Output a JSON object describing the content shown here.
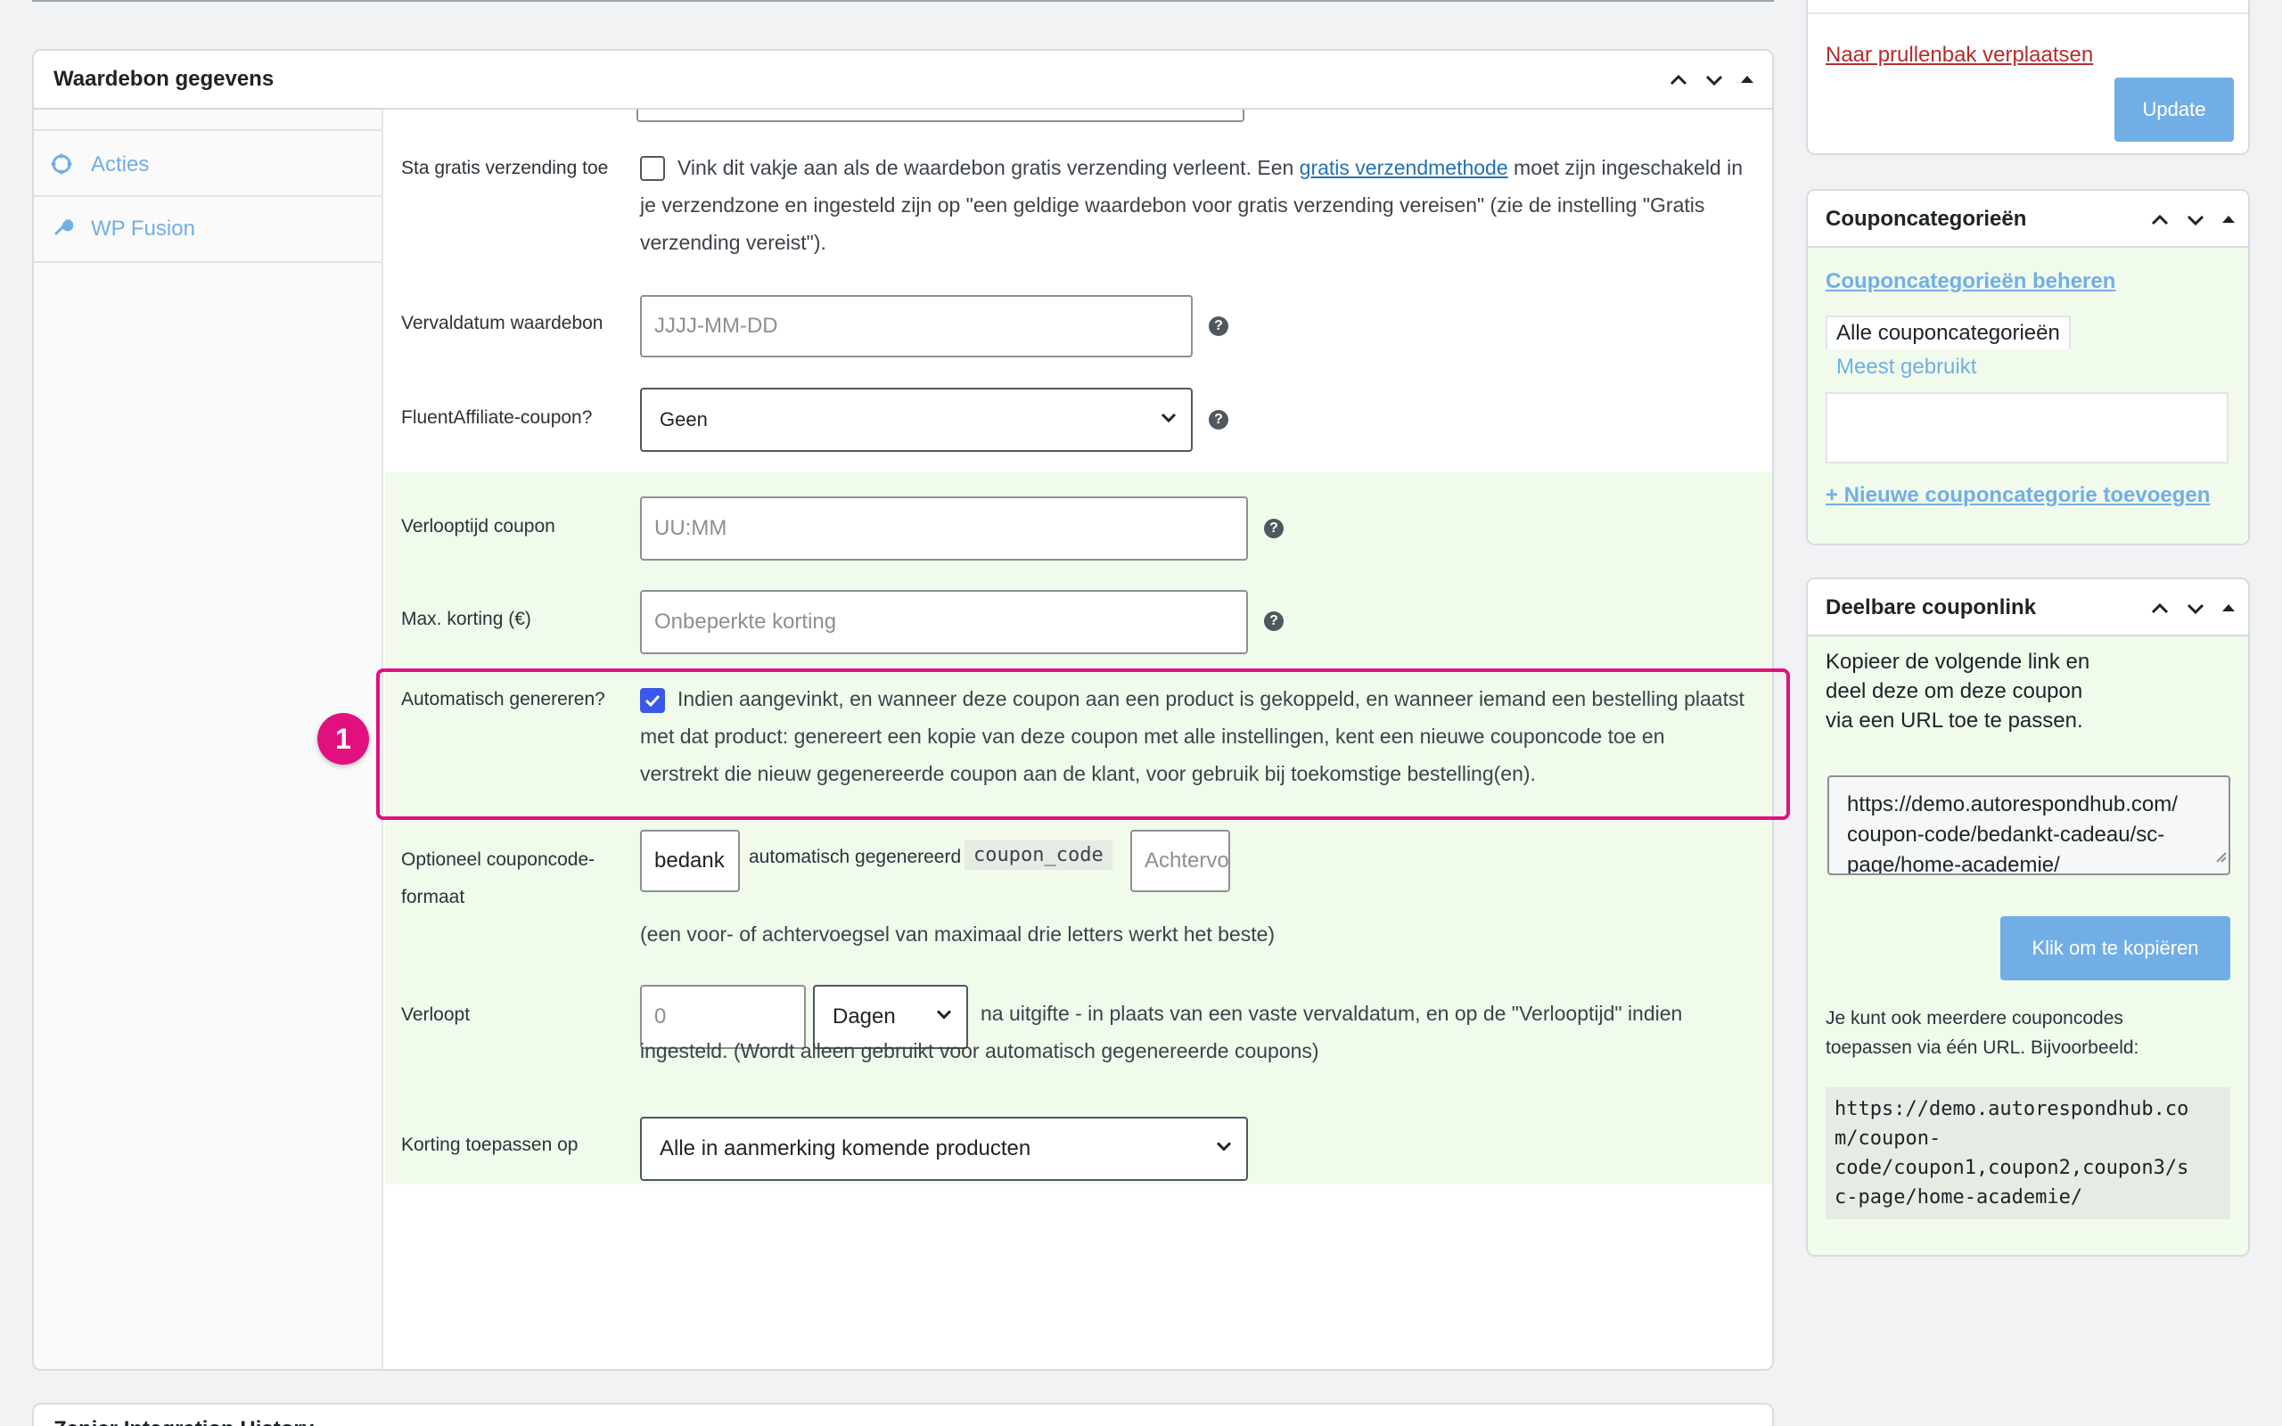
{
  "main_panel": {
    "title": "Waardebon gegevens",
    "sidebar": [
      {
        "label": "Acties",
        "icon": "gear-icon"
      },
      {
        "label": "WP Fusion",
        "icon": "wrench-icon"
      }
    ],
    "free_shipping": {
      "label": "Sta gratis verzending toe",
      "text_before": "Vink dit vakje aan als de waardebon gratis verzending verleent. Een ",
      "link": "gratis verzendmethode",
      "text_after_line1": " moet zijn ingeschakeld in",
      "line2": "je verzendzone en ingesteld zijn op \"een geldige waardebon voor gratis verzending vereisen\" (zie de instelling \"Gratis",
      "line3": "verzending vereist\")."
    },
    "expiry_date": {
      "label": "Vervaldatum waardebon",
      "placeholder": "JJJJ-MM-DD"
    },
    "fluent_affiliate": {
      "label": "FluentAffiliate-coupon?",
      "value": "Geen"
    },
    "expiry_time": {
      "label": "Verlooptijd coupon",
      "placeholder": "UU:MM"
    },
    "max_discount": {
      "label": "Max. korting (€)",
      "placeholder": "Onbeperkte korting"
    },
    "auto_generate": {
      "label": "Automatisch genereren?",
      "checked": true,
      "line1": "Indien aangevinkt, en wanneer deze coupon aan een product is gekoppeld, en wanneer iemand een bestelling plaatst",
      "line2": "met dat product: genereert een kopie van deze coupon met alle instellingen, kent een nieuwe couponcode toe en",
      "line3": "verstrekt die nieuw gegenereerde coupon aan de klant, voor gebruik bij toekomstige bestelling(en).",
      "highlight_color": "#e0117f",
      "step_number": "1"
    },
    "code_format": {
      "label_line1": "Optioneel couponcode-",
      "label_line2": "formaat",
      "prefix_value": "bedank",
      "middle_text": "automatisch gegenereerd",
      "code_tag": "coupon_code",
      "suffix_placeholder": "Achtervoegsel",
      "hint": "(een voor- of achtervoegsel van maximaal drie letters werkt het beste)"
    },
    "expires": {
      "label": "Verloopt",
      "value_placeholder": "0",
      "unit": "Dagen",
      "text_line1": "na uitgifte - in plaats van een vaste vervaldatum, en op de \"Verlooptijd\" indien",
      "text_line2": "ingesteld. (Wordt alleen gebruikt voor automatisch gegenereerde coupons)"
    },
    "apply_to": {
      "label": "Korting toepassen op",
      "value": "Alle in aanmerking komende producten"
    }
  },
  "bottom_panel_title": "Zapier Integration History",
  "publish_box": {
    "trash_link": "Naar prullenbak verplaatsen",
    "update_button": "Update"
  },
  "categories_box": {
    "title": "Couponcategorieën",
    "manage_link": "Couponcategorieën beheren",
    "tab_all": "Alle couponcategorieën",
    "tab_popular": "Meest gebruikt",
    "add_link": "+ Nieuwe couponcategorie toevoegen"
  },
  "share_box": {
    "title": "Deelbare couponlink",
    "intro": [
      "Kopieer de volgende link en",
      "deel deze om deze coupon",
      "via een URL toe te passen."
    ],
    "url_lines": [
      "https://demo.autorespondhub.com/",
      "coupon-code/bedankt-cadeau/sc-",
      "page/home-academie/"
    ],
    "copy_button": "Klik om te kopiëren",
    "multi_text": [
      "Je kunt ook meerdere couponcodes",
      "toepassen via één URL. Bijvoorbeeld:"
    ],
    "example_lines": [
      "https://demo.autorespondhub.co",
      "m/coupon-",
      "code/coupon1,coupon2,coupon3/s",
      "c-page/home-academie/"
    ]
  },
  "colors": {
    "accent": "#2271b1",
    "green_bg": "#f0fbec",
    "button": "#72aee6",
    "trash": "#b32d2e"
  }
}
